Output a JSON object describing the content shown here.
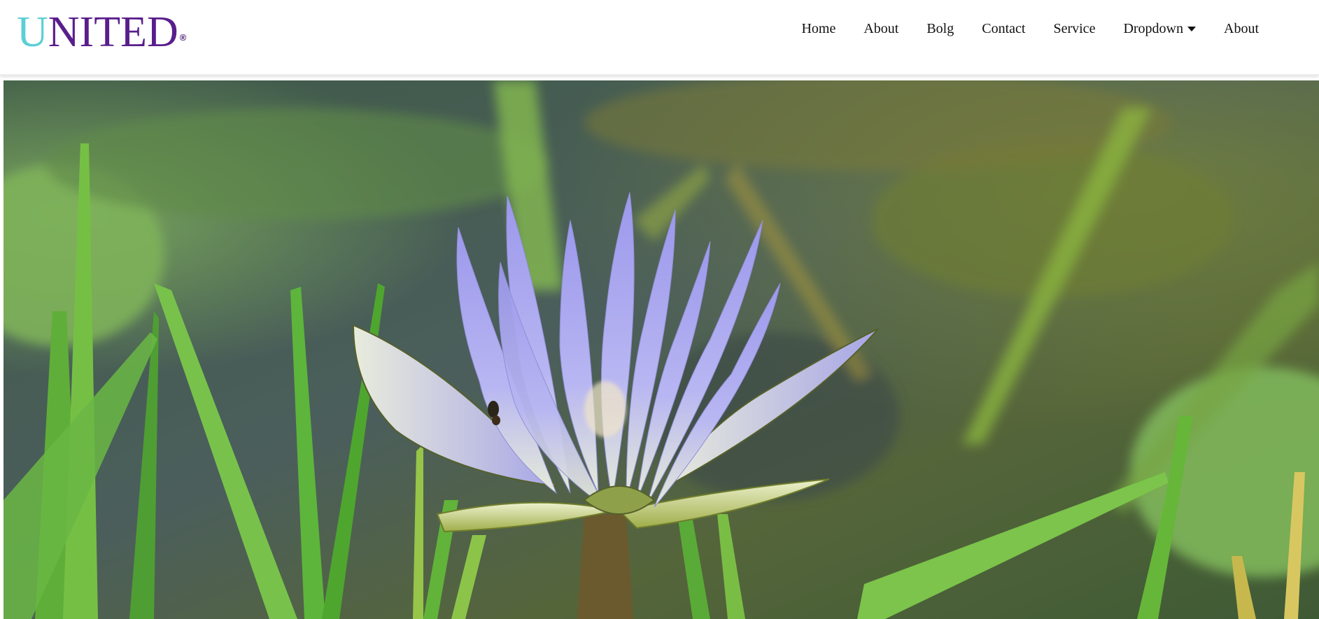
{
  "brand": {
    "first_letter": "U",
    "rest": "NITED",
    "registered": "®",
    "colors": {
      "first_letter": "#5bcfd6",
      "rest": "#5a1e8c"
    }
  },
  "nav": {
    "items": [
      {
        "label": "Home"
      },
      {
        "label": "About"
      },
      {
        "label": "Bolg"
      },
      {
        "label": "Contact"
      },
      {
        "label": "Service"
      },
      {
        "label": "Dropdown",
        "icon": "caret-down-icon"
      },
      {
        "label": "About"
      }
    ]
  },
  "hero": {
    "subject": "water-lily-photo",
    "colors": {
      "petal": "#a9a6ee",
      "leaf": "#7bc04a",
      "water": "#4a5d5f"
    }
  }
}
